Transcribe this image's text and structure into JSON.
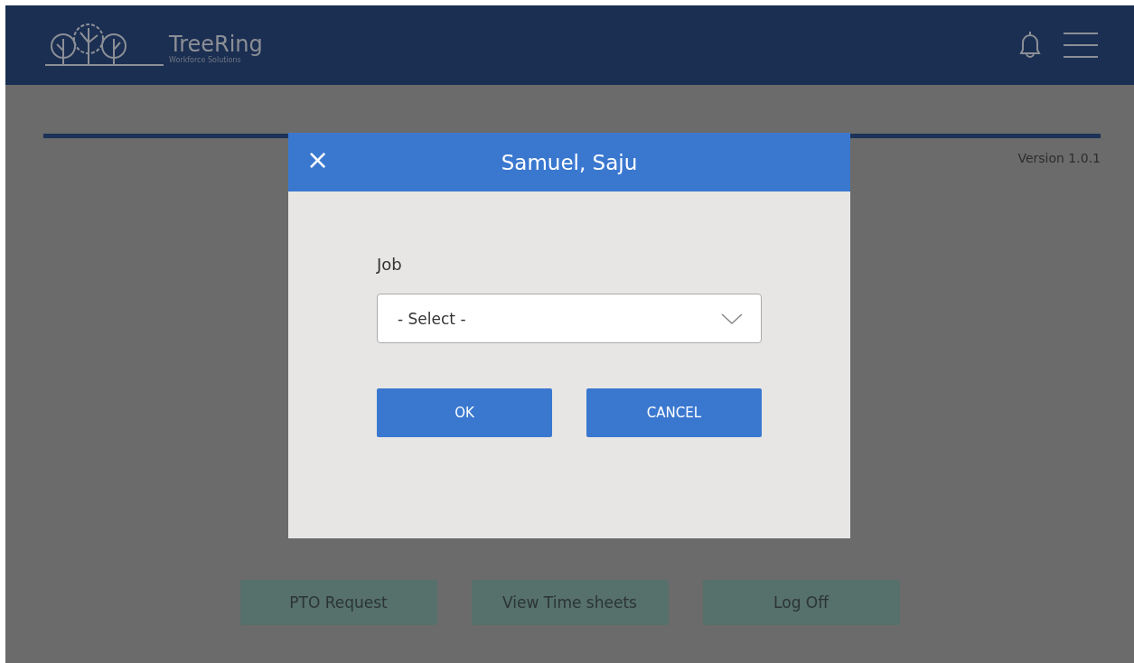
{
  "header": {
    "brand": "TreeRing",
    "tagline": "Workforce Solutions"
  },
  "version": "Version 1.0.1",
  "actions": [
    "PTO Request",
    "View Time sheets",
    "Log Off"
  ],
  "dialog": {
    "close": "×",
    "title": "Samuel, Saju",
    "field_label": "Job",
    "select": {
      "value": "- Select -"
    },
    "buttons": [
      "OK",
      "CANCEL"
    ]
  }
}
